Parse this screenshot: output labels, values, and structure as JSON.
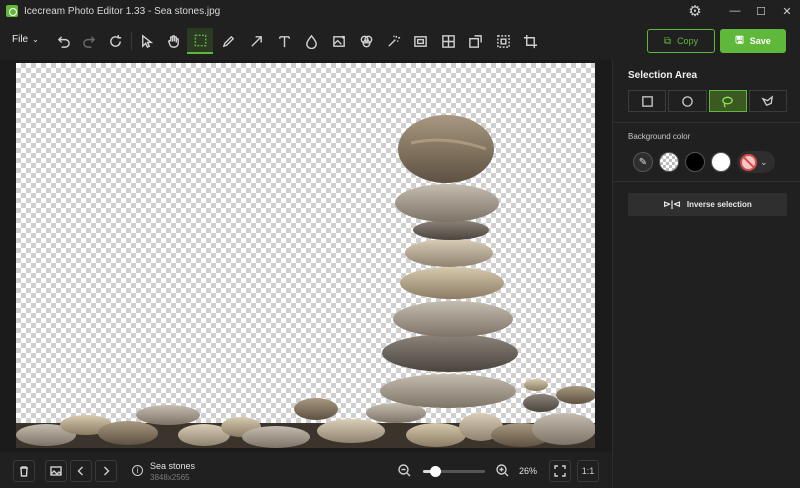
{
  "window": {
    "title": "Icecream Photo Editor 1.33 - Sea stones.jpg",
    "controls": {
      "minimize": "—",
      "maximize": "☐",
      "close": "✕"
    }
  },
  "toolbar": {
    "file_label": "File",
    "tools": [
      {
        "name": "undo-icon"
      },
      {
        "name": "redo-icon"
      },
      {
        "name": "reset-icon"
      },
      {
        "name": "pointer-icon"
      },
      {
        "name": "hand-icon"
      },
      {
        "name": "selection-icon",
        "active": true
      },
      {
        "name": "pencil-icon"
      },
      {
        "name": "arrow-icon"
      },
      {
        "name": "text-icon"
      },
      {
        "name": "drop-icon"
      },
      {
        "name": "image-adjust-icon"
      },
      {
        "name": "filters-icon"
      },
      {
        "name": "magic-wand-icon"
      },
      {
        "name": "frame-icon"
      },
      {
        "name": "collage-icon"
      },
      {
        "name": "resize-icon"
      },
      {
        "name": "select-area-icon"
      },
      {
        "name": "crop-icon"
      }
    ],
    "copy_label": "Copy",
    "save_label": "Save",
    "accent_color": "#5fb83a"
  },
  "panel": {
    "title": "Selection Area",
    "shapes": [
      "rectangle-icon",
      "ellipse-icon",
      "lasso-icon",
      "polygon-lasso-icon"
    ],
    "active_shape": "lasso-icon",
    "background_label": "Background color",
    "swatches": [
      "color-picker-icon",
      "transparent",
      "#000000",
      "#ffffff",
      "no-color"
    ],
    "inverse_label": "Inverse selection"
  },
  "bottom": {
    "file_name": "Sea stones",
    "file_dimensions": "3848x2565",
    "zoom_percent": "26%",
    "zoom_fraction": 0.2,
    "one_to_one": "1:1"
  }
}
